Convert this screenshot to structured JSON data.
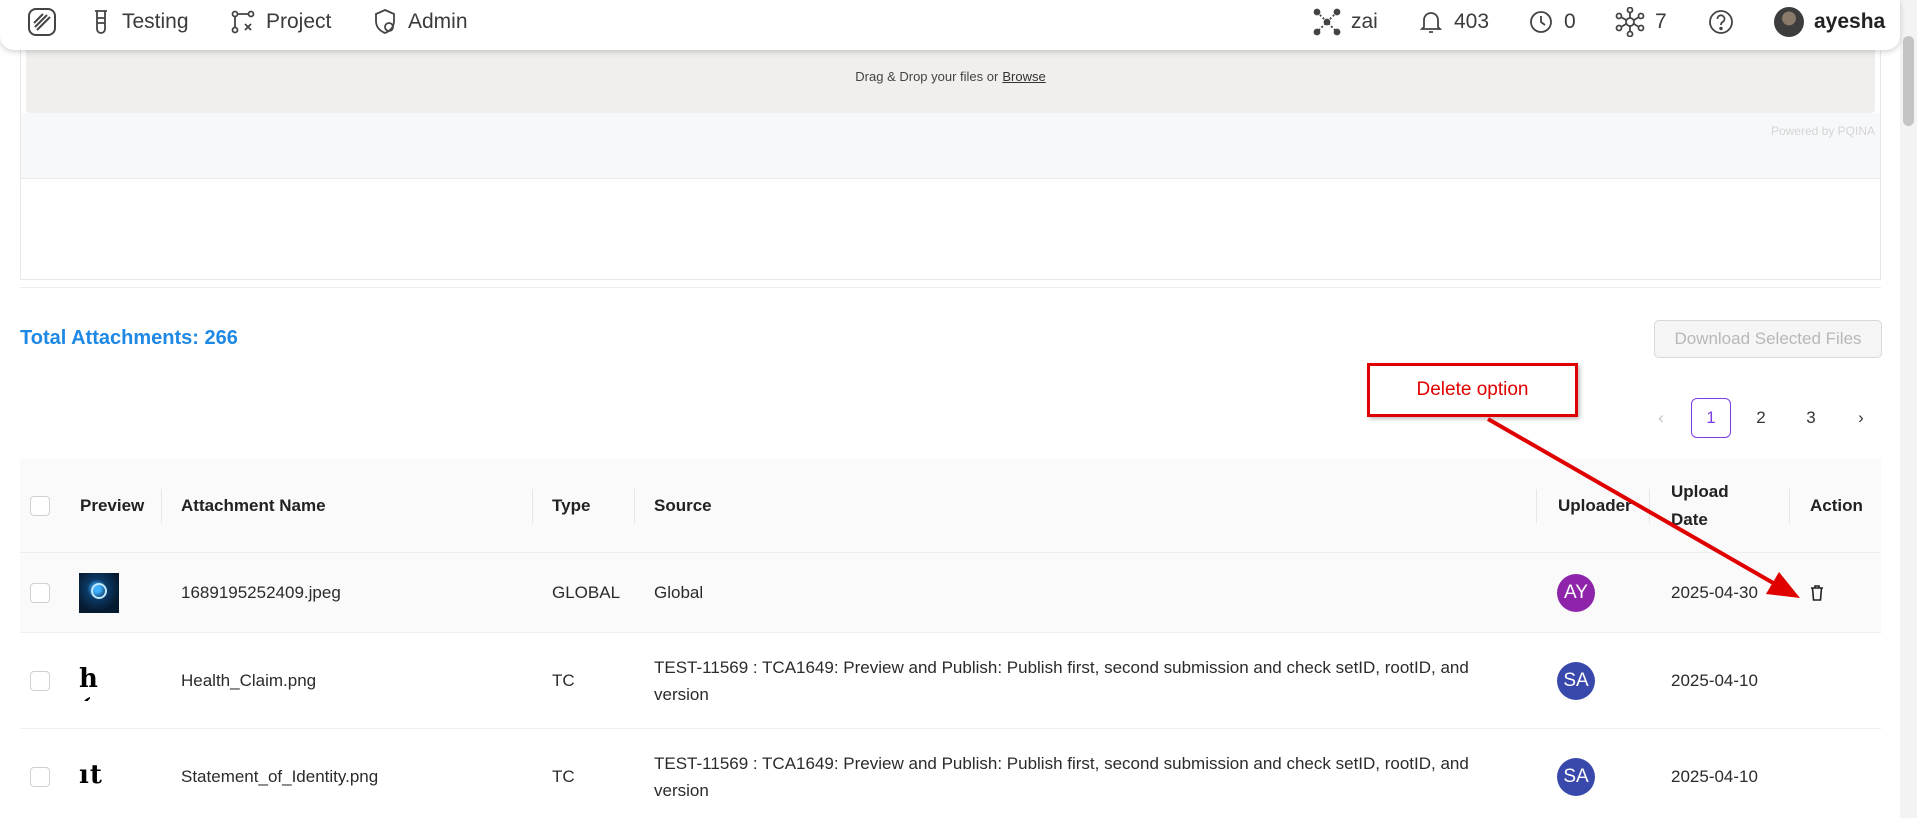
{
  "nav": {
    "items": [
      {
        "label": "Testing",
        "icon": "beaker-icon"
      },
      {
        "label": "Project",
        "icon": "workflow-icon"
      },
      {
        "label": "Admin",
        "icon": "shield-gear-icon"
      }
    ],
    "right": {
      "zai_label": "zai",
      "notifications_count": "403",
      "clock_count": "0",
      "network_count": "7",
      "username": "ayesha"
    }
  },
  "upload": {
    "drop_text": "Drag & Drop your files or",
    "browse_label": "Browse",
    "powered_by": "Powered by PQINA"
  },
  "attachments": {
    "total_label": "Total Attachments: 266",
    "download_label": "Download Selected Files"
  },
  "pagination": {
    "prev": "‹",
    "pages": [
      "1",
      "2",
      "3"
    ],
    "active_page": "1",
    "next": "›"
  },
  "annotation": {
    "label": "Delete option",
    "color": "#e00000"
  },
  "table": {
    "columns": {
      "preview": "Preview",
      "name": "Attachment Name",
      "type": "Type",
      "source": "Source",
      "uploader": "Uploader",
      "upload_date_line1": "Upload",
      "upload_date_line2": "Date",
      "action": "Action"
    },
    "rows": [
      {
        "name": "1689195252409.jpeg",
        "type": "GLOBAL",
        "source": "Global",
        "uploader": "AY",
        "uploader_color": "#8e24aa",
        "date": "2025-04-30",
        "preview_text": ""
      },
      {
        "name": "Health_Claim.png",
        "type": "TC",
        "source": "TEST-11569 : TCA1649: Preview and Publish: Publish first, second submission and check setID, rootID, and version",
        "uploader": "SA",
        "uploader_color": "#3949ab",
        "date": "2025-04-10",
        "preview_text": "h ("
      },
      {
        "name": "Statement_of_Identity.png",
        "type": "TC",
        "source": "TEST-11569 : TCA1649: Preview and Publish: Publish first, second submission and check setID, rootID, and version",
        "uploader": "SA",
        "uploader_color": "#3949ab",
        "date": "2025-04-10",
        "preview_text": "ıt o"
      }
    ]
  },
  "colors": {
    "accent_blue": "#1e88e5",
    "pager_active": "#7b3fe4"
  }
}
